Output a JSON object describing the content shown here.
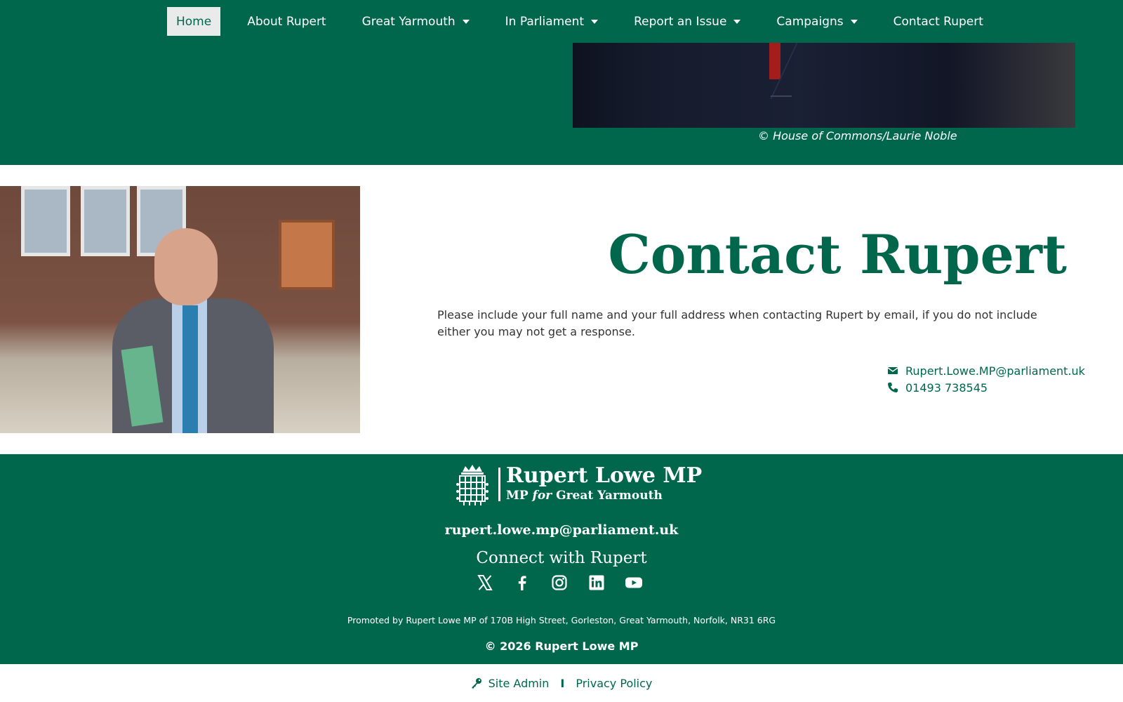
{
  "nav": {
    "items": [
      {
        "label": "Home",
        "active": true,
        "dropdown": false
      },
      {
        "label": "About Rupert",
        "active": false,
        "dropdown": false
      },
      {
        "label": "Great Yarmouth",
        "active": false,
        "dropdown": true
      },
      {
        "label": "In Parliament",
        "active": false,
        "dropdown": true
      },
      {
        "label": "Report an Issue",
        "active": false,
        "dropdown": true
      },
      {
        "label": "Campaigns",
        "active": false,
        "dropdown": true
      },
      {
        "label": "Contact Rupert",
        "active": false,
        "dropdown": false
      }
    ]
  },
  "hero": {
    "credit": "© House of Commons/Laurie Noble"
  },
  "main": {
    "heading": "Contact Rupert",
    "paragraph": "Please include your full name and your full address when contacting Rupert by email, if you do not include either you may not get a response.",
    "email": "Rupert.Lowe.MP@parliament.uk",
    "phone": "01493 738545"
  },
  "footer": {
    "logo_name": "Rupert Lowe MP",
    "logo_sub_prefix": "MP",
    "logo_sub_for": "for",
    "logo_sub_place": "Great Yarmouth",
    "email": "rupert.lowe.mp@parliament.uk",
    "connect": "Connect with Rupert",
    "socials": [
      "x-icon",
      "facebook-icon",
      "instagram-icon",
      "linkedin-icon",
      "youtube-icon"
    ],
    "promoted": "Promoted by Rupert Lowe MP of 170B High Street, Gorleston, Great Yarmouth, Norfolk, NR31 6RG",
    "copyright": "© 2026 Rupert Lowe MP"
  },
  "bottom": {
    "site_admin": "Site Admin",
    "separator": "I",
    "privacy": "Privacy Policy"
  },
  "colors": {
    "brand_green": "#00674c",
    "active_nav_bg": "#e8ebe9",
    "text": "#333333"
  }
}
